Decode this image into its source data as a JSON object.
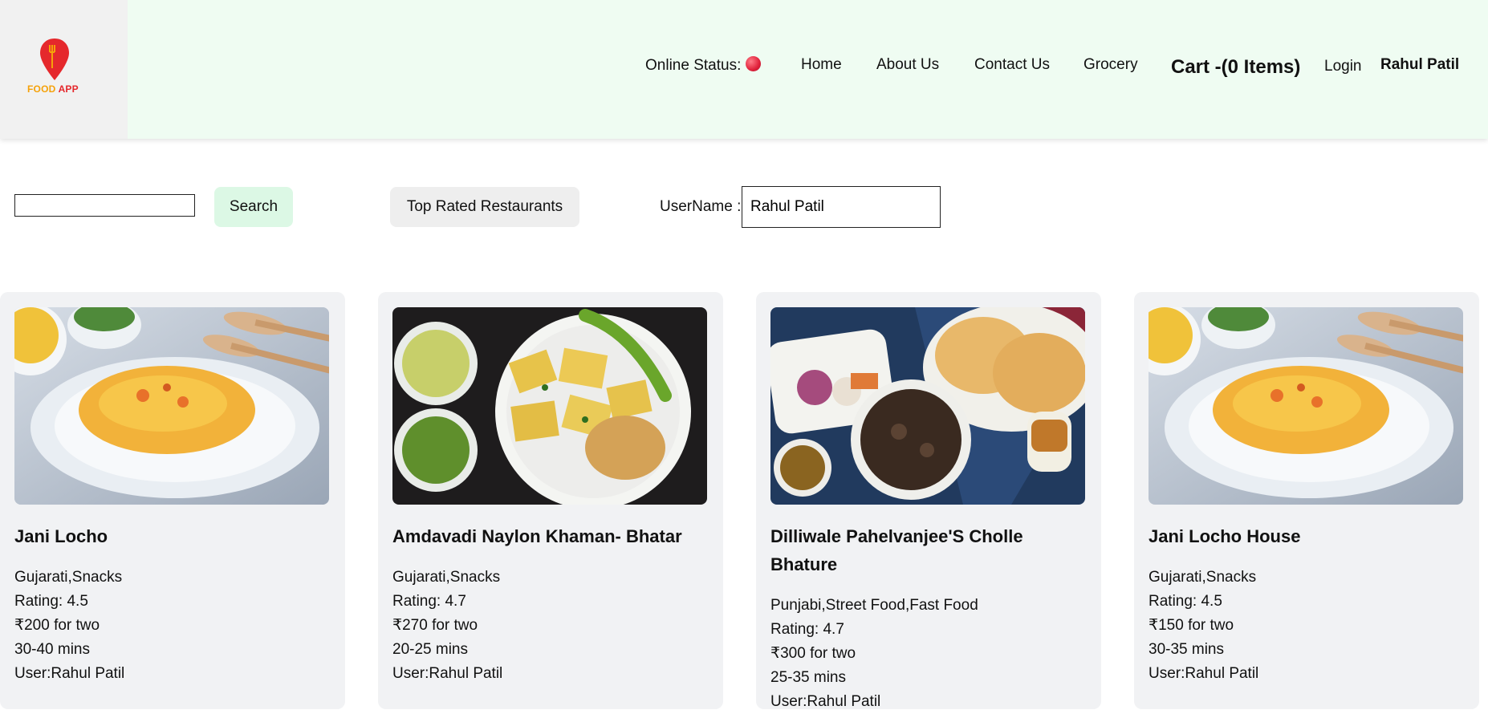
{
  "header": {
    "logo_text_food": "FOOD",
    "logo_text_app": "APP",
    "online_status_label": "Online Status:",
    "nav": [
      "Home",
      "About Us",
      "Contact Us",
      "Grocery"
    ],
    "cart_label": "Cart -(0 Items)",
    "login_label": "Login",
    "user_name": "Rahul Patil",
    "status_color": "#e0213a",
    "background_color": "#effcf2"
  },
  "toolbar": {
    "search_value": "",
    "search_button": "Search",
    "top_rated_button": "Top Rated Restaurants",
    "username_label": "UserName :",
    "username_value": "Rahul Patil"
  },
  "restaurants": [
    {
      "name": "Jani Locho",
      "cuisines": "Gujarati,Snacks",
      "rating": "Rating: 4.5",
      "cost": "₹200 for two",
      "time": "30-40 mins",
      "user": "User:Rahul Patil",
      "image_icon": "locho-dish-image"
    },
    {
      "name": "Amdavadi Naylon Khaman- Bhatar",
      "cuisines": "Gujarati,Snacks",
      "rating": "Rating: 4.7",
      "cost": "₹270 for two",
      "time": "20-25 mins",
      "user": "User:Rahul Patil",
      "image_icon": "khaman-dish-image"
    },
    {
      "name": "Dilliwale Pahelvanjee'S Cholle Bhature",
      "cuisines": "Punjabi,Street Food,Fast Food",
      "rating": "Rating: 4.7",
      "cost": "₹300 for two",
      "time": "25-35 mins",
      "user": "User:Rahul Patil",
      "image_icon": "chole-bhature-dish-image"
    },
    {
      "name": "Jani Locho House",
      "cuisines": "Gujarati,Snacks",
      "rating": "Rating: 4.5",
      "cost": "₹150 for two",
      "time": "30-35 mins",
      "user": "User:Rahul Patil",
      "image_icon": "locho-dish-image"
    }
  ]
}
